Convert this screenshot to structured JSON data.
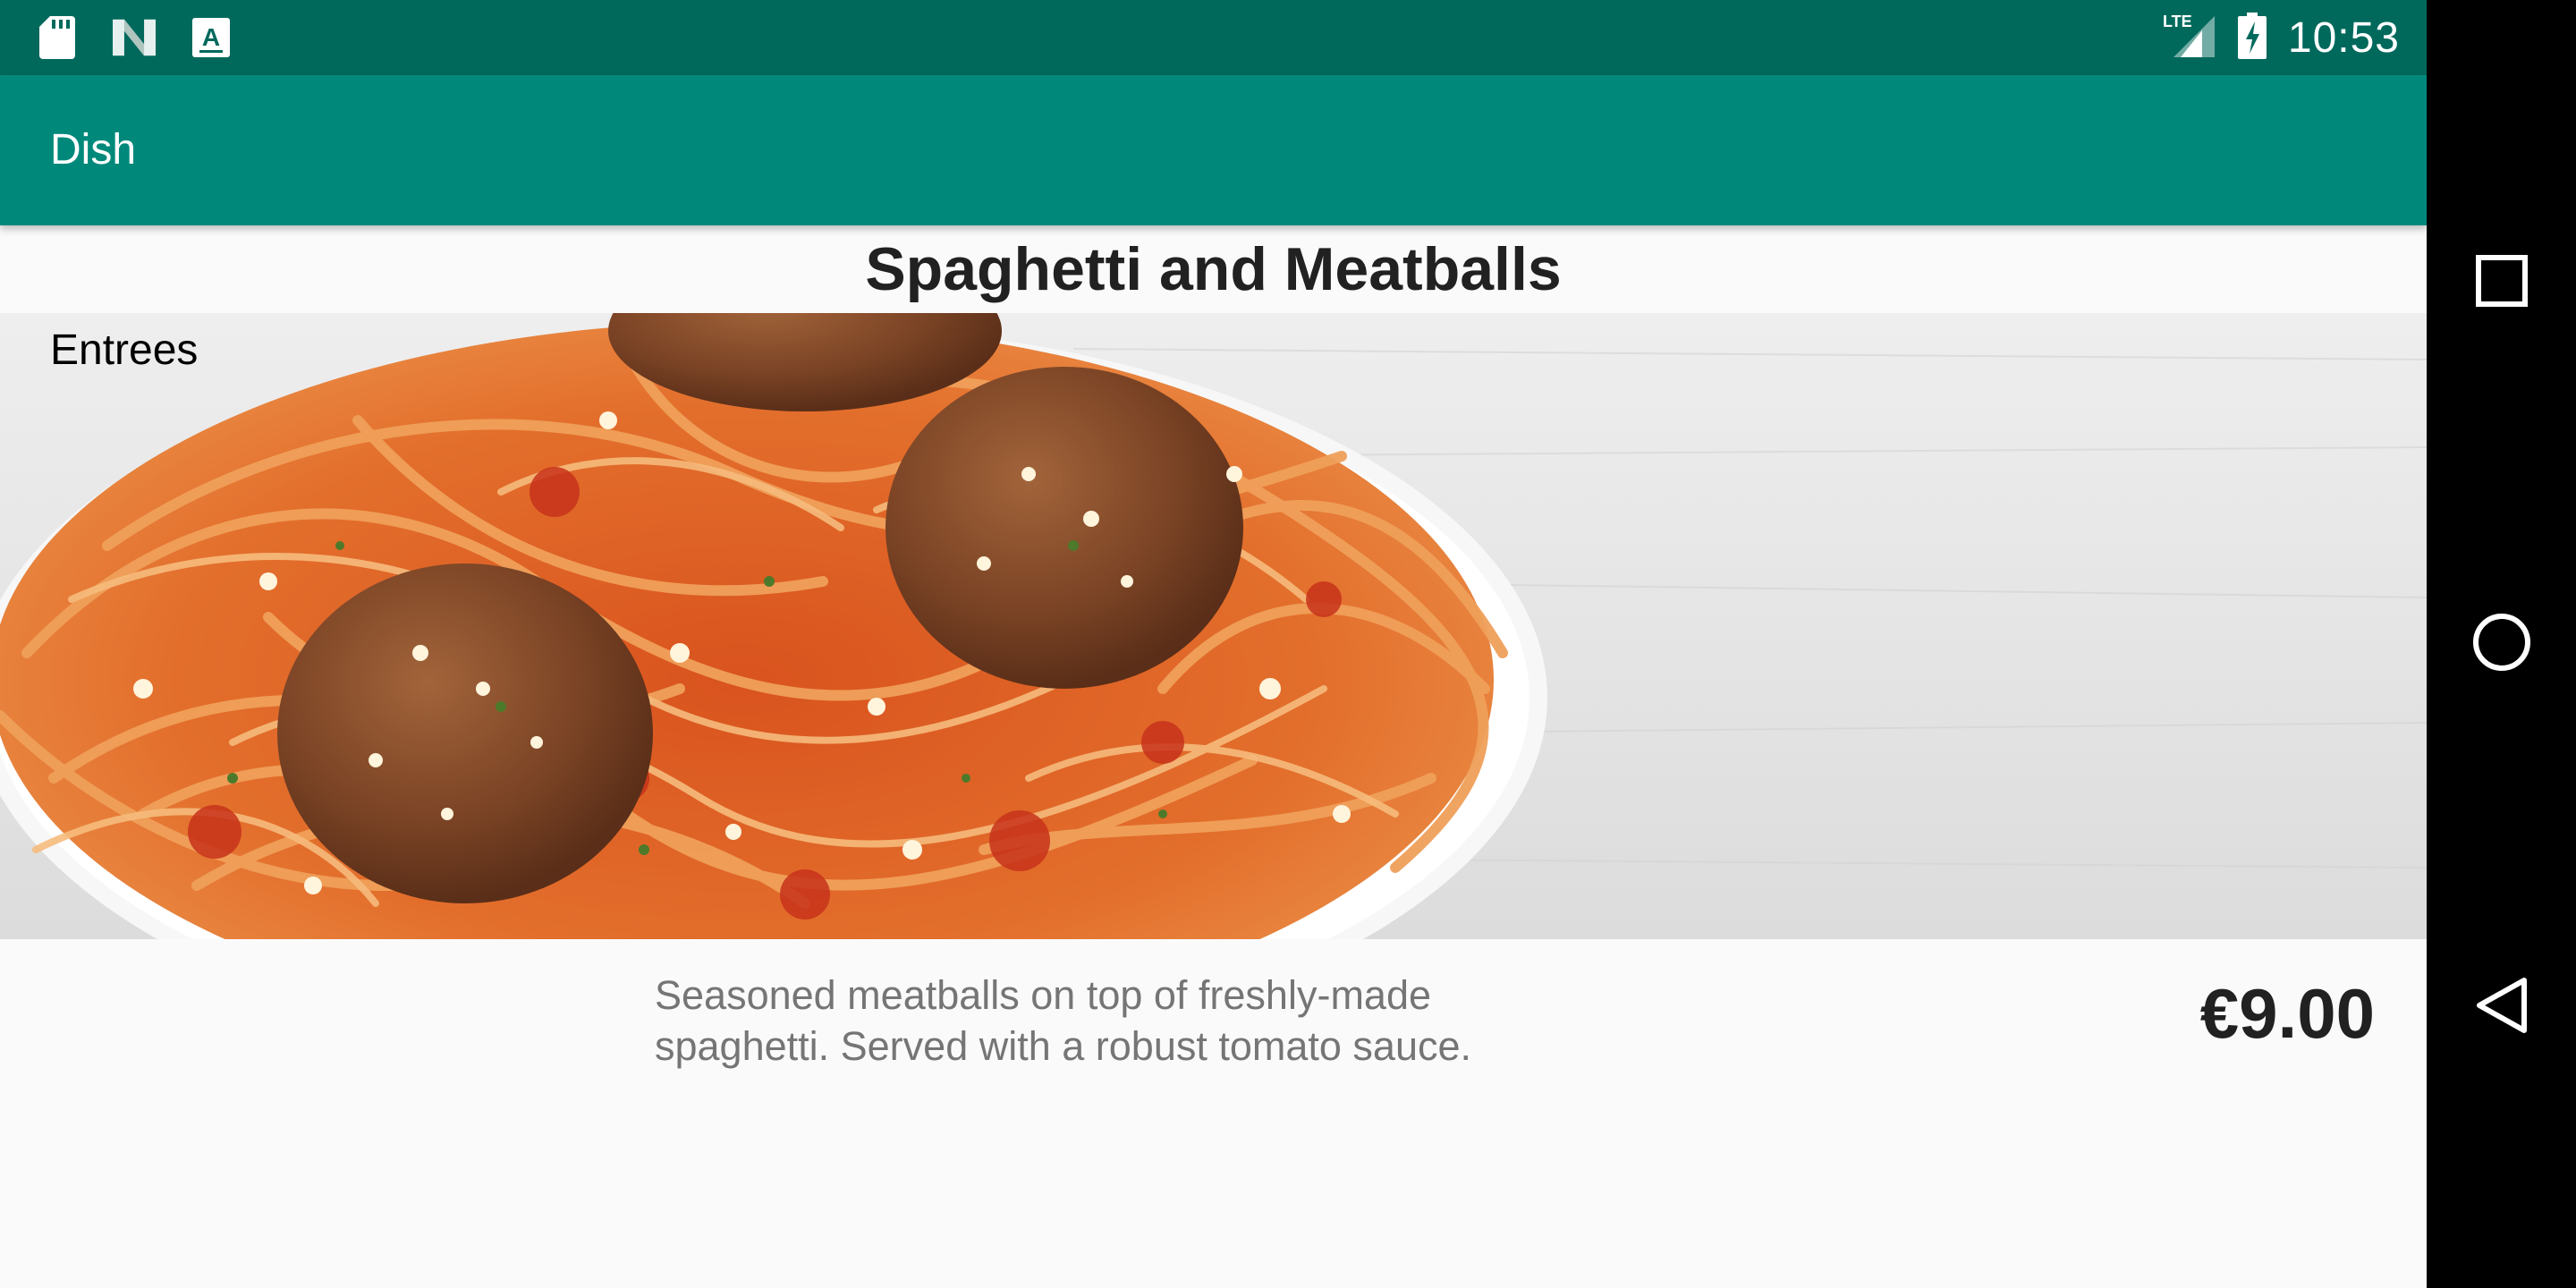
{
  "status_bar": {
    "time": "10:53",
    "network": "LTE",
    "icons_left": [
      "sd-card-icon",
      "n-logo-icon",
      "font-a-icon"
    ],
    "background": "#00695c"
  },
  "app_bar": {
    "title": "Dish",
    "background": "#00897b"
  },
  "dish": {
    "title": "Spaghetti and Meatballs",
    "category": "Entrees",
    "description": "Seasoned meatballs on top of freshly-made spaghetti. Served with a robust tomato sauce.",
    "price": "€9.00",
    "image": "spaghetti-meatballs-photo"
  },
  "nav_bar": {
    "buttons": [
      "recents-icon",
      "home-icon",
      "back-icon"
    ]
  }
}
